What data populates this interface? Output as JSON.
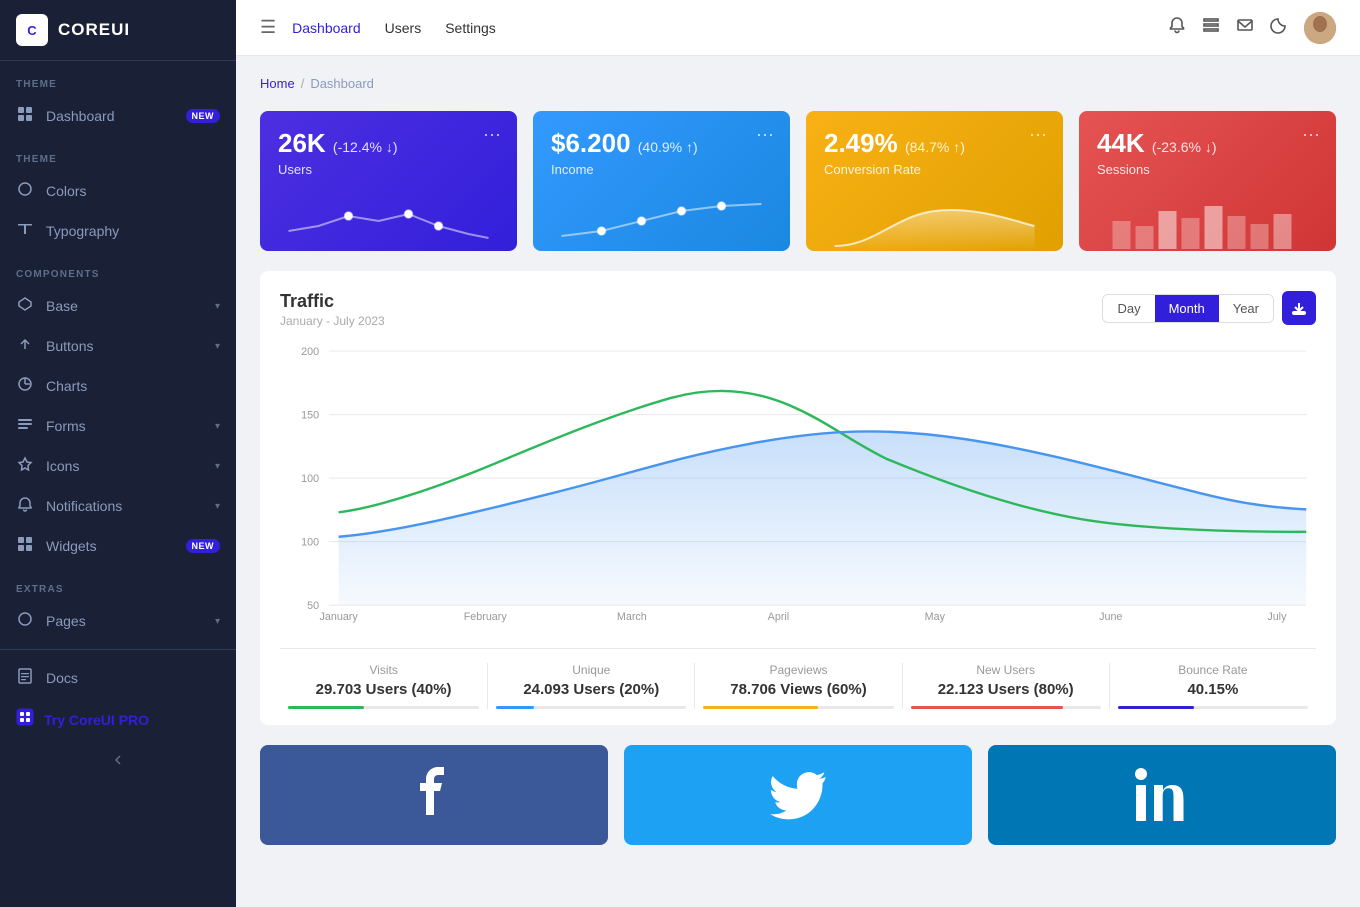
{
  "sidebar": {
    "logo": {
      "icon": "C",
      "text": "COREUI"
    },
    "theme_label": "THEME",
    "components_label": "COMPONENTS",
    "extras_label": "EXTRAS",
    "items": {
      "dashboard": {
        "label": "Dashboard",
        "badge": "NEW",
        "icon": "⊡"
      },
      "colors": {
        "label": "Colors",
        "icon": "○"
      },
      "typography": {
        "label": "Typography",
        "icon": "✏"
      },
      "base": {
        "label": "Base",
        "icon": "⬡",
        "has_chevron": true
      },
      "buttons": {
        "label": "Buttons",
        "icon": "▷",
        "has_chevron": true
      },
      "charts": {
        "label": "Charts",
        "icon": "◎"
      },
      "forms": {
        "label": "Forms",
        "icon": "☰",
        "has_chevron": true
      },
      "icons": {
        "label": "Icons",
        "icon": "☆",
        "has_chevron": true
      },
      "notifications": {
        "label": "Notifications",
        "icon": "🔔",
        "has_chevron": true
      },
      "widgets": {
        "label": "Widgets",
        "badge": "NEW",
        "icon": "⊞"
      },
      "pages": {
        "label": "Pages",
        "icon": "○",
        "has_chevron": true
      },
      "docs": {
        "label": "Docs",
        "icon": "☰"
      },
      "try_pro": {
        "label": "Try CoreUI PRO",
        "icon": "◈"
      }
    }
  },
  "header": {
    "hamburger_icon": "☰",
    "nav": [
      {
        "label": "Dashboard",
        "active": true
      },
      {
        "label": "Users"
      },
      {
        "label": "Settings"
      }
    ],
    "icons": {
      "bell": "🔔",
      "list": "≡",
      "mail": "✉",
      "moon": "🌙"
    }
  },
  "breadcrumb": {
    "home": "Home",
    "separator": "/",
    "current": "Dashboard"
  },
  "stats_cards": [
    {
      "id": "users",
      "value": "26K",
      "change": "(-12.4% ↓)",
      "label": "Users",
      "color": "purple"
    },
    {
      "id": "income",
      "value": "$6.200",
      "change": "(40.9% ↑)",
      "label": "Income",
      "color": "blue"
    },
    {
      "id": "conversion",
      "value": "2.49%",
      "change": "(84.7% ↑)",
      "label": "Conversion Rate",
      "color": "yellow"
    },
    {
      "id": "sessions",
      "value": "44K",
      "change": "(-23.6% ↓)",
      "label": "Sessions",
      "color": "red"
    }
  ],
  "traffic": {
    "title": "Traffic",
    "subtitle": "January - July 2023",
    "controls": {
      "day": "Day",
      "month": "Month",
      "year": "Year",
      "active": "Month"
    },
    "y_labels": [
      "200",
      "150",
      "100",
      "50"
    ],
    "x_labels": [
      "January",
      "February",
      "March",
      "April",
      "May",
      "June",
      "July"
    ],
    "stats": [
      {
        "label": "Visits",
        "value": "29.703 Users (40%)",
        "bar_color": "green",
        "bar_pct": 40
      },
      {
        "label": "Unique",
        "value": "24.093 Users (20%)",
        "bar_color": "blue",
        "bar_pct": 20
      },
      {
        "label": "Pageviews",
        "value": "78.706 Views (60%)",
        "bar_color": "yellow",
        "bar_pct": 60
      },
      {
        "label": "New Users",
        "value": "22.123 Users (80%)",
        "bar_color": "red",
        "bar_pct": 80
      },
      {
        "label": "Bounce Rate",
        "value": "40.15%",
        "bar_color": "purple",
        "bar_pct": 40
      }
    ]
  },
  "social_cards": [
    {
      "id": "facebook",
      "icon": "f",
      "color": "#3b5998"
    },
    {
      "id": "twitter",
      "icon": "🐦",
      "color": "#1da1f2"
    },
    {
      "id": "linkedin",
      "icon": "in",
      "color": "#0077b5"
    }
  ]
}
